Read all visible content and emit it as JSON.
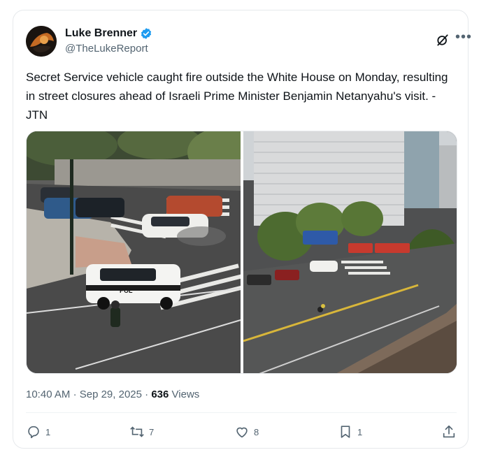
{
  "tweet": {
    "author": {
      "display_name": "Luke Brenner",
      "handle": "@TheLukeReport",
      "verified": true
    },
    "text": "Secret Service vehicle caught fire outside the White House on Monday, resulting in street closures ahead of Israeli Prime Minister Benjamin Netanyahu's visit. -JTN",
    "media": {
      "left_image_text": "POL"
    },
    "time": "10:40 AM",
    "date": "Sep 29, 2025",
    "separator": "·",
    "views_count": "636",
    "views_label": "Views",
    "stats": {
      "replies": "1",
      "reposts": "7",
      "likes": "8",
      "bookmarks": "1"
    }
  },
  "icons": {
    "verified": "verified-badge-icon",
    "grok": "grok-icon",
    "more": "more-icon",
    "reply": "reply-icon",
    "repost": "repost-icon",
    "like": "like-icon",
    "bookmark": "bookmark-icon",
    "share": "share-icon"
  },
  "colors": {
    "verified": "#1d9bf0",
    "secondary_text": "#536471",
    "primary_text": "#0f1419"
  }
}
